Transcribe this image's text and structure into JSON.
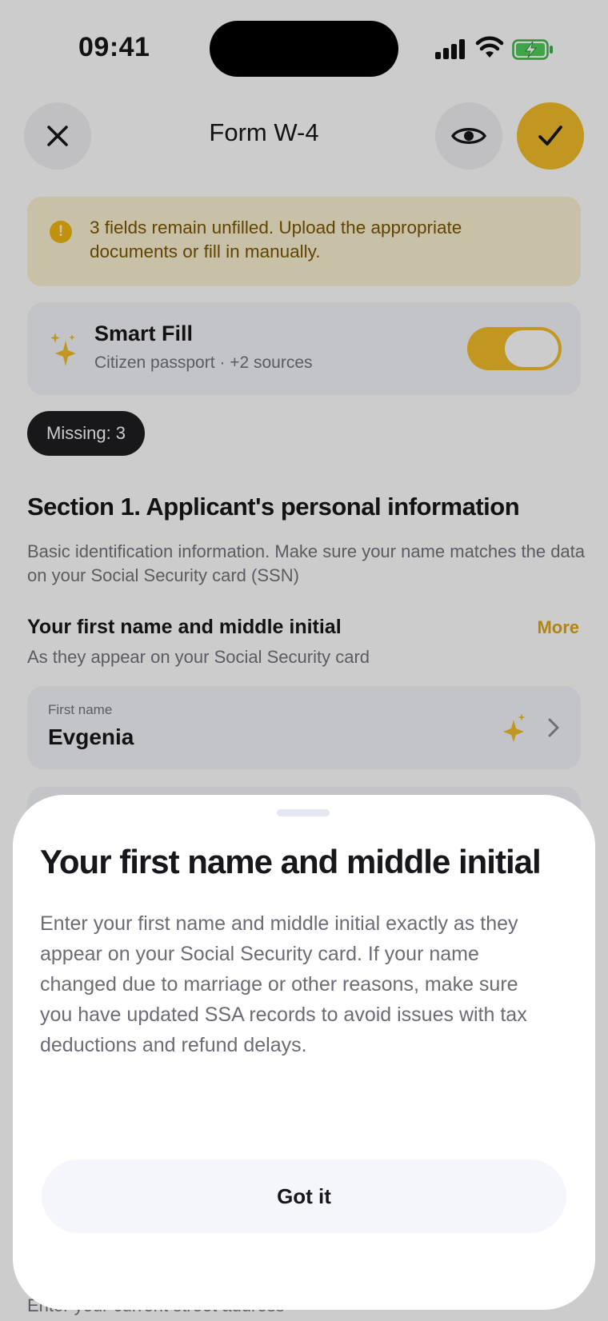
{
  "status_bar": {
    "time": "09:41"
  },
  "header": {
    "title": "Form W-4",
    "close_icon": "close-icon",
    "preview_icon": "eye-icon",
    "done_icon": "check-icon"
  },
  "warning": {
    "text": "3 fields remain unfilled. Upload the appropriate documents or fill in manually.",
    "icon": "!"
  },
  "smart_fill": {
    "title": "Smart Fill",
    "subtitle": "Citizen passport · +2 sources",
    "enabled": true
  },
  "missing_badge": "Missing: 3",
  "section": {
    "title": "Section 1. Applicant's personal information",
    "description": "Basic identification information. Make sure your name matches the data on your Social Security card (SSN)"
  },
  "field": {
    "label": "Your first name and middle initial",
    "more_label": "More",
    "hint": "As they appear on your Social Security card",
    "input_label": "First name",
    "input_value": "Evgenia"
  },
  "bottom_peek": {
    "hint": "Enter your current street address"
  },
  "sheet": {
    "title": "Your first name and middle initial",
    "body": "Enter your first name and middle initial exactly as they appear on your Social Security card. If your name changed due to marriage or other reasons, make sure you have updated SSA records to avoid issues with tax deductions and refund delays.",
    "button_label": "Got it"
  },
  "colors": {
    "accent": "#f3bd2a",
    "warning_bg": "#fbf2d3",
    "warning_text": "#7a5600",
    "card_bg": "#f4f5fa"
  }
}
